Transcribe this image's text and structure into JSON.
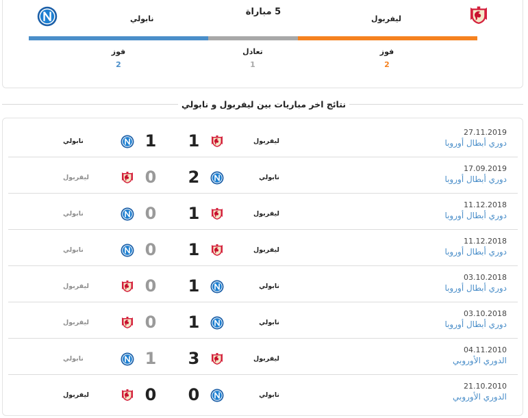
{
  "colors": {
    "home": "#f58220",
    "draw": "#a8a8a8",
    "away": "#4a8ec9",
    "competition_link": "#4a8ec9"
  },
  "summary": {
    "title": "5 مباراة",
    "home_team": "ليفربول",
    "away_team": "نابولي",
    "home_logo": "liverpool-crest-icon",
    "away_logo": "napoli-crest-icon",
    "home_win_label": "فوز",
    "draw_label": "تعادل",
    "away_win_label": "فوز",
    "home_wins": "2",
    "draws": "1",
    "away_wins": "2"
  },
  "section_title": "نتائج اخر مباريات بين ليفربول و نابولي",
  "matches": [
    {
      "date": "27.11.2019",
      "competition": "دوري أبطال أوروبا",
      "home": "ليفربول",
      "home_logo": "liverpool-crest-icon",
      "home_score": "1",
      "away_score": "1",
      "away": "نابولي",
      "away_logo": "napoli-crest-icon",
      "winner": "draw"
    },
    {
      "date": "17.09.2019",
      "competition": "دوري أبطال أوروبا",
      "home": "نابولي",
      "home_logo": "napoli-crest-icon",
      "home_score": "2",
      "away_score": "0",
      "away": "ليفربول",
      "away_logo": "liverpool-crest-icon",
      "winner": "home"
    },
    {
      "date": "11.12.2018",
      "competition": "دوري أبطال أوروبا",
      "home": "ليفربول",
      "home_logo": "liverpool-crest-icon",
      "home_score": "1",
      "away_score": "0",
      "away": "نابولي",
      "away_logo": "napoli-crest-icon",
      "winner": "home"
    },
    {
      "date": "11.12.2018",
      "competition": "دوري أبطال أوروبا",
      "home": "ليفربول",
      "home_logo": "liverpool-crest-icon",
      "home_score": "1",
      "away_score": "0",
      "away": "نابولي",
      "away_logo": "napoli-crest-icon",
      "winner": "home"
    },
    {
      "date": "03.10.2018",
      "competition": "دوري أبطال أوروبا",
      "home": "نابولي",
      "home_logo": "napoli-crest-icon",
      "home_score": "1",
      "away_score": "0",
      "away": "ليفربول",
      "away_logo": "liverpool-crest-icon",
      "winner": "home"
    },
    {
      "date": "03.10.2018",
      "competition": "دوري أبطال أوروبا",
      "home": "نابولي",
      "home_logo": "napoli-crest-icon",
      "home_score": "1",
      "away_score": "0",
      "away": "ليفربول",
      "away_logo": "liverpool-crest-icon",
      "winner": "home"
    },
    {
      "date": "04.11.2010",
      "competition": "الدوري الأوروبي",
      "home": "ليفربول",
      "home_logo": "liverpool-crest-icon",
      "home_score": "3",
      "away_score": "1",
      "away": "نابولي",
      "away_logo": "napoli-crest-icon",
      "winner": "home"
    },
    {
      "date": "21.10.2010",
      "competition": "الدوري الأوروبي",
      "home": "نابولي",
      "home_logo": "napoli-crest-icon",
      "home_score": "0",
      "away_score": "0",
      "away": "ليفربول",
      "away_logo": "liverpool-crest-icon",
      "winner": "draw"
    }
  ]
}
